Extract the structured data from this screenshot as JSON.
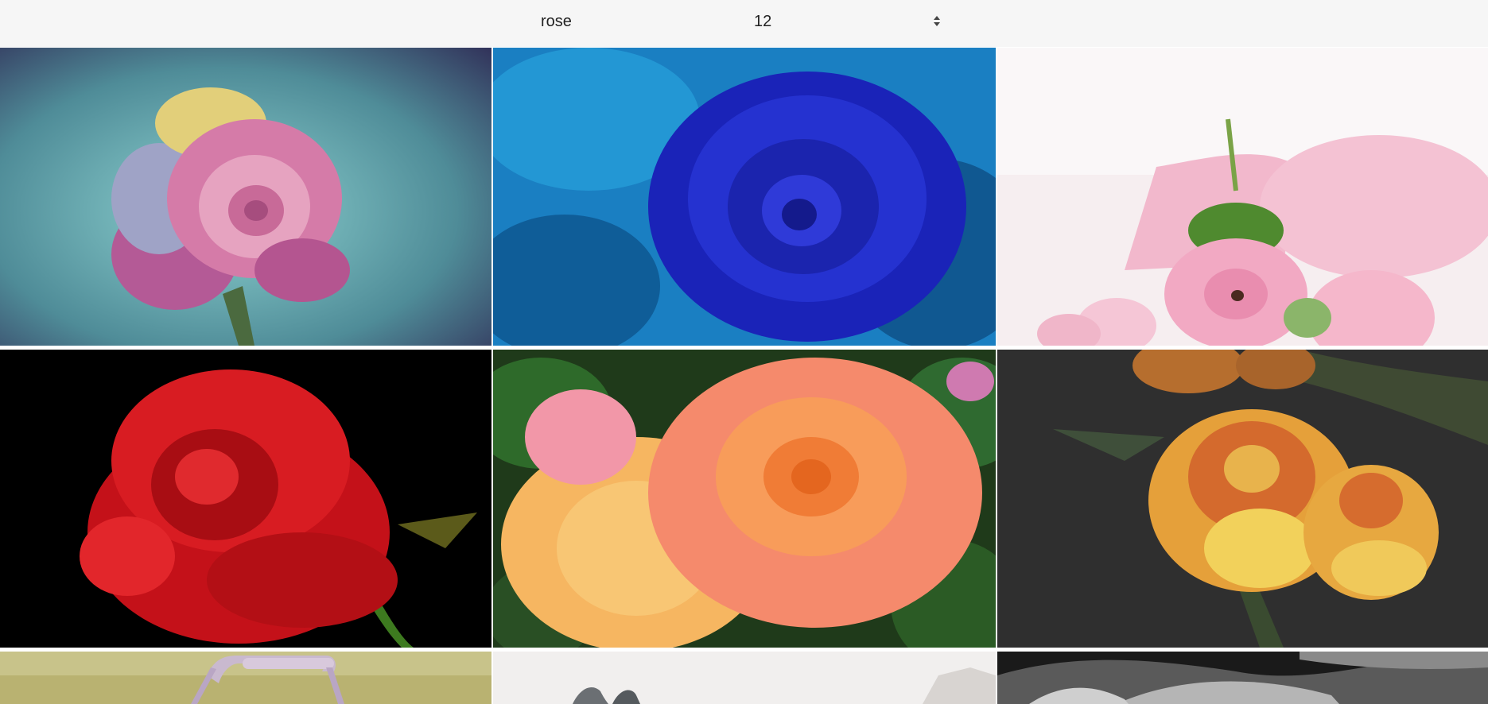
{
  "search": {
    "query": "rose"
  },
  "count": {
    "value": "12"
  },
  "images": [
    {
      "name": "rainbow-rose-image"
    },
    {
      "name": "blue-rose-image"
    },
    {
      "name": "pink-ranunculus-image"
    },
    {
      "name": "red-rose-image"
    },
    {
      "name": "orange-roses-image"
    },
    {
      "name": "yellow-red-roses-image"
    },
    {
      "name": "basket-image"
    },
    {
      "name": "white-rose-image"
    },
    {
      "name": "grayscale-rose-image"
    }
  ]
}
